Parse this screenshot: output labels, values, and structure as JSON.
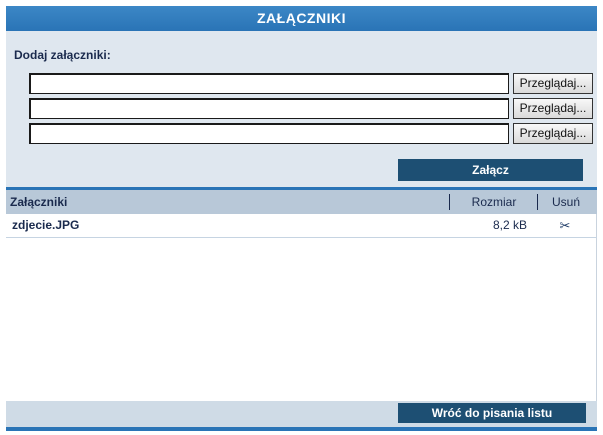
{
  "window": {
    "title": "ZAŁĄCZNIKI"
  },
  "add_section": {
    "label": "Dodaj załączniki:",
    "file_inputs": [
      {
        "value": "",
        "browse_label": "Przeglądaj..."
      },
      {
        "value": "",
        "browse_label": "Przeglądaj..."
      },
      {
        "value": "",
        "browse_label": "Przeglądaj..."
      }
    ],
    "attach_button": "Załącz"
  },
  "table": {
    "headers": {
      "name": "Załączniki",
      "size": "Rozmiar",
      "delete": "Usuń"
    },
    "rows": [
      {
        "name": "zdjecie.JPG",
        "size": "8,2 kB",
        "delete_icon": "scissors-icon"
      }
    ]
  },
  "footer": {
    "back_button": "Wróć do pisania listu"
  },
  "colors": {
    "title_bar": "#2a74b6",
    "panel_bg": "#dfe7ef",
    "button_dark": "#1d4f73",
    "header_bg": "#b8c8d8"
  }
}
